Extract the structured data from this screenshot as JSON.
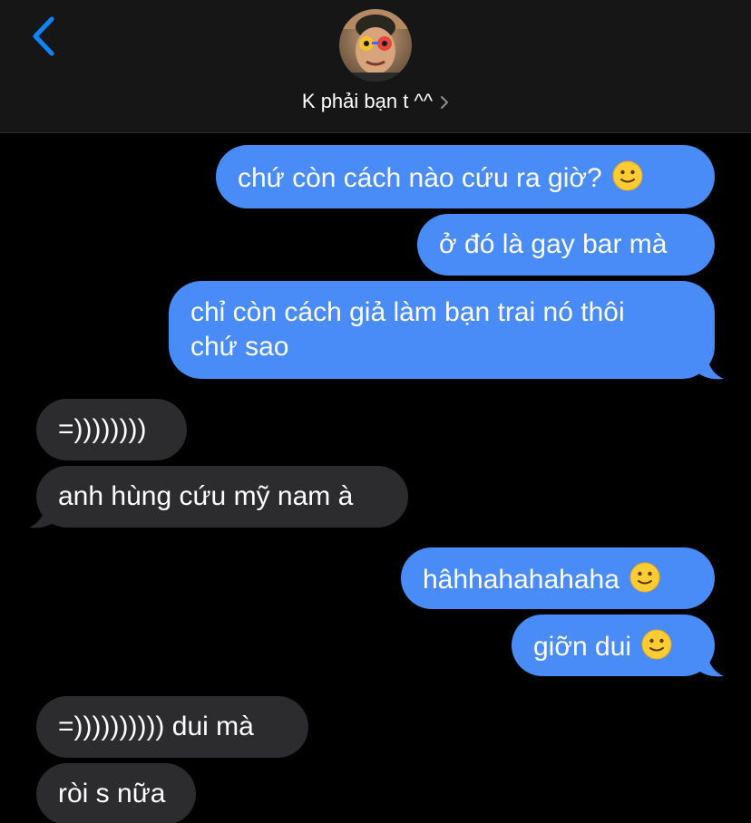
{
  "header": {
    "back_icon": "chevron-left-icon",
    "contact_name": "K phải bạn t ^^",
    "chevron_icon": "chevron-right-icon"
  },
  "colors": {
    "outgoing_bubble": "#4a8cf7",
    "incoming_bubble": "#2c2c2e",
    "accent": "#0a84ff",
    "background": "#000000",
    "header_background": "#161616"
  },
  "messages": [
    {
      "direction": "outgoing",
      "text": "chứ còn cách nào cứu ra giờ?",
      "emoji": "slightly-smiling-face"
    },
    {
      "direction": "outgoing",
      "text": "ở đó là gay bar mà"
    },
    {
      "direction": "outgoing",
      "text": "chỉ còn cách giả làm bạn trai nó thôi\nchứ sao"
    },
    {
      "direction": "incoming",
      "text": "=))))))))"
    },
    {
      "direction": "incoming",
      "text": "anh hùng cứu mỹ nam à"
    },
    {
      "direction": "outgoing",
      "text": "hâhhahahahaha",
      "emoji": "slightly-smiling-face"
    },
    {
      "direction": "outgoing",
      "text": "giỡn dui",
      "emoji": "slightly-smiling-face"
    },
    {
      "direction": "incoming",
      "text": "=)))))))))) dui mà"
    },
    {
      "direction": "incoming",
      "text": "ròi s nữa"
    }
  ]
}
